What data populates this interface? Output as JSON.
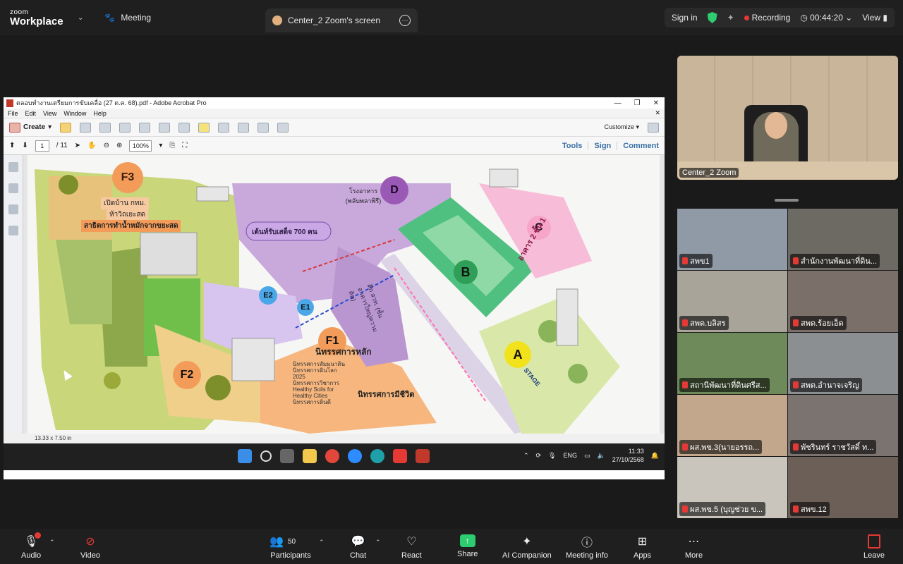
{
  "topbar": {
    "brand_small": "zoom",
    "brand_main": "Workplace",
    "meeting_label": "Meeting",
    "screen_tab_label": "Center_2 Zoom's screen",
    "sign_in": "Sign in",
    "recording_label": "Recording",
    "timer": "00:44:20",
    "view_label": "View"
  },
  "acrobat": {
    "title": "ตลอบทำงานเตรียมการขับเคลื่อ (27 ต.ค. 68).pdf - Adobe Acrobat Pro",
    "menu": [
      "File",
      "Edit",
      "View",
      "Window",
      "Help"
    ],
    "create_label": "Create",
    "customize_label": "Customize",
    "page_current": "1",
    "page_total": "/ 11",
    "zoom_value": "100%",
    "tools_label": "Tools",
    "sign_label": "Sign",
    "comment_label": "Comment",
    "status_size": "13.33 x 7.50 in"
  },
  "map": {
    "zones": {
      "F3": "F3",
      "D": "D",
      "C": "C",
      "B": "B",
      "E2": "E2",
      "E1": "E1",
      "F1": "F1",
      "F2": "F2",
      "A": "A"
    },
    "labels": {
      "f3_open": "เปิดบ้าน กทม.",
      "f3_sub": "ห้าวิถเยะสด",
      "f3_demo": "สาธิตการทำน้ำหมักจากขยะสด",
      "d_building": "โรงอาหาร (พลับพลาพิรี)",
      "seats": "เต้นท์รับเสด็จ 700 คน",
      "c_building": "อาคาร 2 ชั้น 1",
      "f1_title": "นิทรรศการหลัก",
      "f1_items": "นิทรรศการสัมมนาดิน\nนิทรรศการดินโลก 2025\nนิทรรศการวิชาการ\nHealthy Soils for\nHealthy Cities\nนิทรรศการดินดี",
      "f1_life": "นิทรรศการมีชีวิต",
      "stage": "STAGE",
      "building_b": "ตึก สวท. (ชั้นอาคารใหญ่ความคิด)"
    }
  },
  "taskbar": {
    "lang": "ENG",
    "time": "11:33",
    "date": "27/10/2568"
  },
  "video": {
    "speaker_name": "Center_2 Zoom",
    "tiles": [
      {
        "name": "สพข1",
        "muted": true,
        "bg": "#8f9aa6"
      },
      {
        "name": "สำนักงานพัฒนาที่ดิน...",
        "muted": true,
        "bg": "#6d6a63"
      },
      {
        "name": "สพด.บลิสร",
        "muted": true,
        "bg": "#a8a49a"
      },
      {
        "name": "สพด.ร้อยเอ็ด",
        "muted": true,
        "bg": "#7b6f6a"
      },
      {
        "name": "สถานีพัฒนาที่ดินศรีส...",
        "muted": true,
        "bg": "#6f8a5a"
      },
      {
        "name": "สพด.อำนาจเจริญ",
        "muted": true,
        "bg": "#8c8f92"
      },
      {
        "name": "ผส.พข.3(นายอรรถ...",
        "muted": true,
        "bg": "#c2a78c"
      },
      {
        "name": "พัชรินทร์ ราชวัสดิ์ ท...",
        "muted": true,
        "bg": "#7a7370"
      },
      {
        "name": "ผส.พข.5 (บุญช่วย ข...",
        "muted": true,
        "bg": "#c9c4bc"
      },
      {
        "name": "สพข.12",
        "muted": true,
        "bg": "#6b5f58"
      }
    ]
  },
  "toolbar": {
    "audio": "Audio",
    "video": "Video",
    "participants": "Participants",
    "participants_count": "50",
    "chat": "Chat",
    "react": "React",
    "share": "Share",
    "ai": "AI Companion",
    "info": "Meeting info",
    "apps": "Apps",
    "more": "More",
    "leave": "Leave"
  },
  "colors": {
    "accent_green": "#2ecc71",
    "record_red": "#e53935",
    "zone_orange": "#f39c5a",
    "zone_purple": "#9b59b6",
    "zone_pink": "#f7a6c8",
    "zone_yellow": "#f2e21b"
  }
}
